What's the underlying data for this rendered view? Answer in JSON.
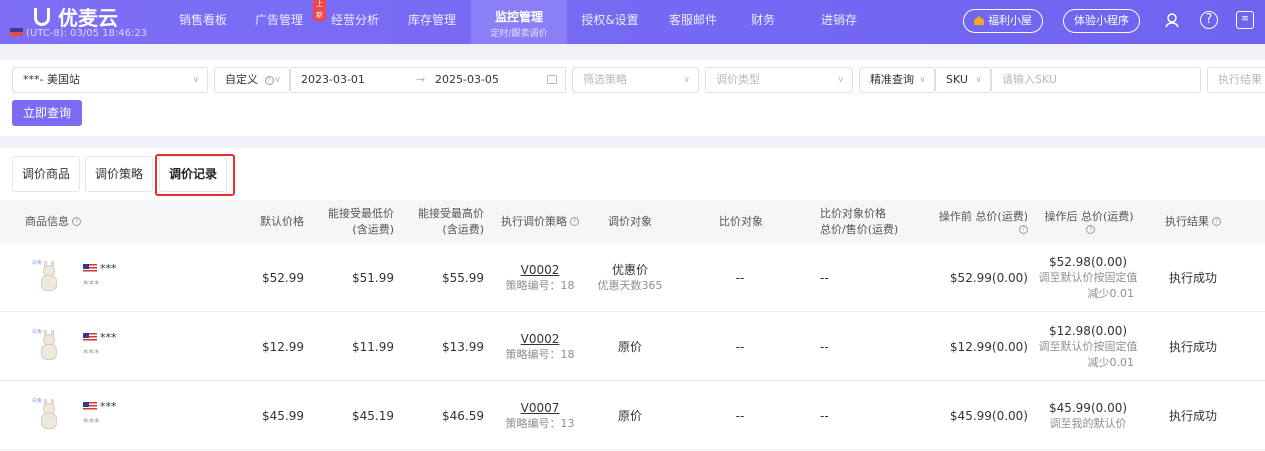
{
  "header": {
    "logo_text": "优麦云",
    "timezone": "(UTC-8): 03/05 18:46:23",
    "nav": [
      {
        "label": "销售看板"
      },
      {
        "label": "广告管理"
      },
      {
        "label": "经营分析",
        "badge": "上新"
      },
      {
        "label": "库存管理"
      },
      {
        "label": "监控管理",
        "sub": "定时/跟卖调价",
        "active": true
      },
      {
        "label": "授权&设置"
      },
      {
        "label": "客服邮件"
      },
      {
        "label": "财务"
      },
      {
        "label": "进销存"
      }
    ],
    "welfare_button": "福利小屋",
    "miniapp_button": "体验小程序",
    "help_icon_text": "?"
  },
  "filters": {
    "site": "***- 美国站",
    "date_mode": "自定义",
    "date_start": "2023-03-01",
    "date_sep": "→",
    "date_end": "2025-03-05",
    "strategy_placeholder": "筛选策略",
    "price_type_placeholder": "调价类型",
    "match_mode": "精准查询",
    "search_field": "SKU",
    "sku_placeholder": "请输入SKU",
    "result_placeholder": "执行结果",
    "query_button": "立即查询"
  },
  "tabs": [
    {
      "label": "调价商品"
    },
    {
      "label": "调价策略"
    },
    {
      "label": "调价记录",
      "active": true
    }
  ],
  "table": {
    "headers": {
      "product": "商品信息",
      "default_price": "默认价格",
      "min_price_1": "能接受最低价",
      "min_price_2": "(含运费)",
      "max_price_1": "能接受最高价",
      "max_price_2": "(含运费)",
      "strategy": "执行调价策略",
      "target": "调价对象",
      "compare": "比价对象",
      "compare_price_1": "比价对象价格",
      "compare_price_2": "总价/售价(运费)",
      "before": "操作前 总价(运费)",
      "after": "操作后 总价(运费)",
      "result": "执行结果"
    },
    "rows": [
      {
        "thumb_tag": "白兔",
        "name": "***",
        "sku": "***",
        "default_price": "$52.99",
        "min_price": "$51.99",
        "max_price": "$55.99",
        "strategy_code": "V0002",
        "strategy_no": "策略编号：18",
        "target": "优惠价",
        "target_sub": "优惠天数365",
        "compare": "--",
        "compare_price": "--",
        "before": "$52.99(0.00)",
        "after": "$52.98(0.00)",
        "after_note_1": "调至默认价按固定值",
        "after_note_2": "减少0.01",
        "result": "执行成功"
      },
      {
        "thumb_tag": "白兔",
        "name": "***",
        "sku": "***",
        "default_price": "$12.99",
        "min_price": "$11.99",
        "max_price": "$13.99",
        "strategy_code": "V0002",
        "strategy_no": "策略编号：18",
        "target": "原价",
        "target_sub": "",
        "compare": "--",
        "compare_price": "--",
        "before": "$12.99(0.00)",
        "after": "$12.98(0.00)",
        "after_note_1": "调至默认价按固定值",
        "after_note_2": "减少0.01",
        "result": "执行成功"
      },
      {
        "thumb_tag": "白兔",
        "name": "***",
        "sku": "***",
        "default_price": "$45.99",
        "min_price": "$45.19",
        "max_price": "$46.59",
        "strategy_code": "V0007",
        "strategy_no": "策略编号：13",
        "target": "原价",
        "target_sub": "",
        "compare": "--",
        "compare_price": "--",
        "before": "$45.99(0.00)",
        "after": "$45.99(0.00)",
        "after_note_1": "调至我的默认价",
        "after_note_2": "",
        "result": "执行成功"
      }
    ]
  }
}
